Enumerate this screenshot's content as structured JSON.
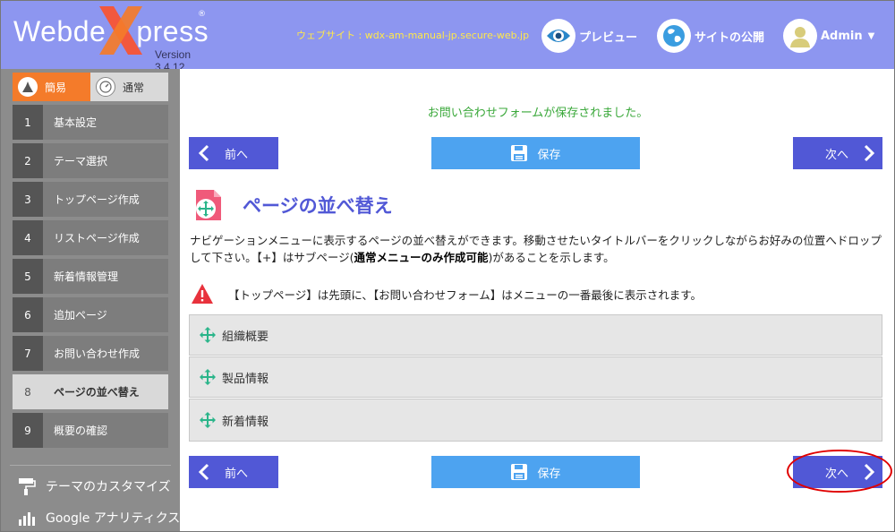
{
  "header": {
    "logo_text_a": "Webde",
    "logo_text_b": "press",
    "logo_reg": "®",
    "version": "Version 3.4.12",
    "site_url": "ウェブサイト : wdx-am-manual-jp.secure-web.jp",
    "preview_label": "プレビュー",
    "publish_label": "サイトの公開",
    "admin_label": "Admin",
    "colors": {
      "bg": "#8d96f0",
      "url": "#ffe84a"
    }
  },
  "sidebar": {
    "mode_easy": "簡易",
    "mode_normal": "通常",
    "steps": [
      {
        "num": "1",
        "label": "基本設定"
      },
      {
        "num": "2",
        "label": "テーマ選択"
      },
      {
        "num": "3",
        "label": "トップページ作成"
      },
      {
        "num": "4",
        "label": "リストページ作成"
      },
      {
        "num": "5",
        "label": "新着情報管理"
      },
      {
        "num": "6",
        "label": "追加ページ"
      },
      {
        "num": "7",
        "label": "お問い合わせ作成"
      },
      {
        "num": "8",
        "label": "ページの並べ替え"
      },
      {
        "num": "9",
        "label": "概要の確認"
      }
    ],
    "active_step": "8",
    "links": [
      {
        "label": "テーマのカスタマイズ",
        "icon": "paint-roller-icon"
      },
      {
        "label": "Google アナリティクス",
        "icon": "bar-chart-icon"
      }
    ]
  },
  "main": {
    "saved_message": "お問い合わせフォームが保存されました。",
    "prev_label": "前へ",
    "save_label": "保存",
    "next_label": "次へ",
    "title": "ページの並べ替え",
    "description_1": "ナビゲーションメニューに表示するページの並べ替えができます。移動させたいタイトルバーをクリックしながらお好みの位置へドロップして下さい。【+】はサブページ(",
    "description_bold": "通常メニューのみ作成可能",
    "description_2": ")があることを示します。",
    "warning": "【トップページ】は先頭に、【お問い合わせフォーム】はメニューの一番最後に表示されます。",
    "menu_items": [
      "組織概要",
      "製品情報",
      "新着情報"
    ],
    "colors": {
      "primary": "#5158d6",
      "save": "#4da3f0",
      "success": "#3aa83a",
      "warn": "#e8323c"
    }
  }
}
